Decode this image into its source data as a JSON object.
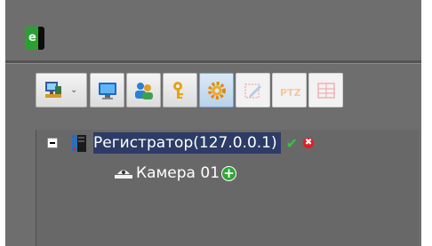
{
  "app": {
    "logo_letter": "e"
  },
  "toolbar": {
    "buttons": [
      {
        "name": "network-computer-icon",
        "has_dropdown": true
      },
      {
        "name": "monitor-icon"
      },
      {
        "name": "users-icon"
      },
      {
        "name": "key-icon"
      },
      {
        "name": "gear-icon",
        "state": "active"
      },
      {
        "name": "edit-icon",
        "state": "disabled"
      },
      {
        "name": "ptz-icon",
        "state": "disabled",
        "label": "PTZ"
      },
      {
        "name": "layout-icon",
        "state": "disabled"
      }
    ],
    "chevron": "⌄"
  },
  "tree": {
    "recorder": {
      "label": "Регистратор(127.0.0.1)",
      "status_ok": "✔",
      "status_error": "✖"
    },
    "camera": {
      "label": "Камера 01",
      "add_symbol": "+"
    }
  },
  "colors": {
    "background": "#6e6e6e",
    "selection": "#2d3c66",
    "ok": "#38c23e",
    "error": "#d9212a",
    "add": "#2fa63a"
  }
}
